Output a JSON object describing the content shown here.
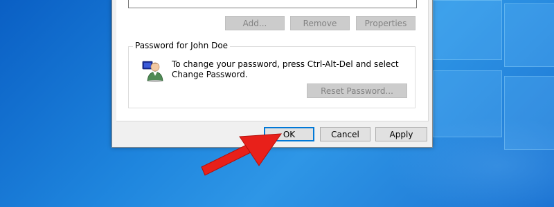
{
  "dialog": {
    "buttons_top": {
      "add_label": "Add...",
      "remove_label": "Remove",
      "properties_label": "Properties"
    },
    "password_group": {
      "title": "Password for John Doe",
      "description": "To change your password, press Ctrl-Alt-Del and select Change Password.",
      "reset_label": "Reset Password..."
    },
    "footer": {
      "ok_label": "OK",
      "cancel_label": "Cancel",
      "apply_label": "Apply"
    }
  },
  "icons": {
    "user": "user-with-key-icon",
    "annotation": "red-arrow-icon"
  },
  "colors": {
    "annotation_arrow": "#e8201a",
    "desktop_blue": "#1f86de",
    "default_button_border": "#0078d7"
  }
}
